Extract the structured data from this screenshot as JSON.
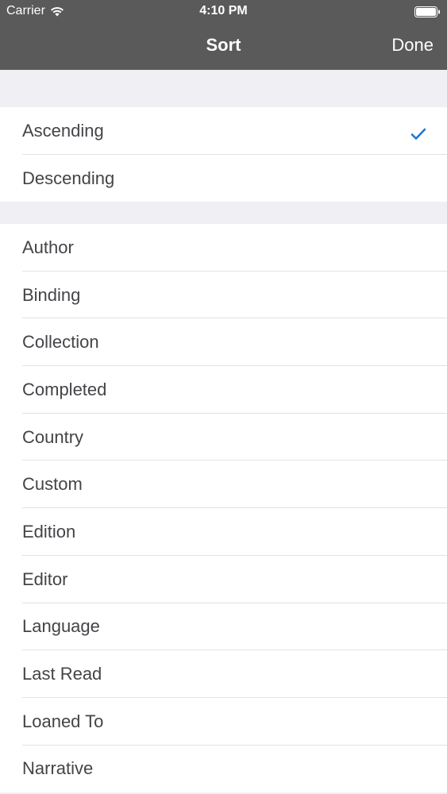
{
  "status_bar": {
    "carrier": "Carrier",
    "time": "4:10 PM",
    "wifi_icon": "wifi-icon",
    "battery_icon": "battery-icon"
  },
  "nav": {
    "title": "Sort",
    "done_label": "Done"
  },
  "order_options": [
    {
      "label": "Ascending",
      "selected": true
    },
    {
      "label": "Descending",
      "selected": false
    }
  ],
  "sort_fields": [
    {
      "label": "Author"
    },
    {
      "label": "Binding"
    },
    {
      "label": "Collection"
    },
    {
      "label": "Completed"
    },
    {
      "label": "Country"
    },
    {
      "label": "Custom"
    },
    {
      "label": "Edition"
    },
    {
      "label": "Editor"
    },
    {
      "label": "Language"
    },
    {
      "label": "Last Read"
    },
    {
      "label": "Loaned To"
    },
    {
      "label": "Narrative"
    }
  ],
  "colors": {
    "header_bg": "#5a5a5a",
    "checkmark": "#1a7ad4",
    "background": "#efeff4"
  }
}
